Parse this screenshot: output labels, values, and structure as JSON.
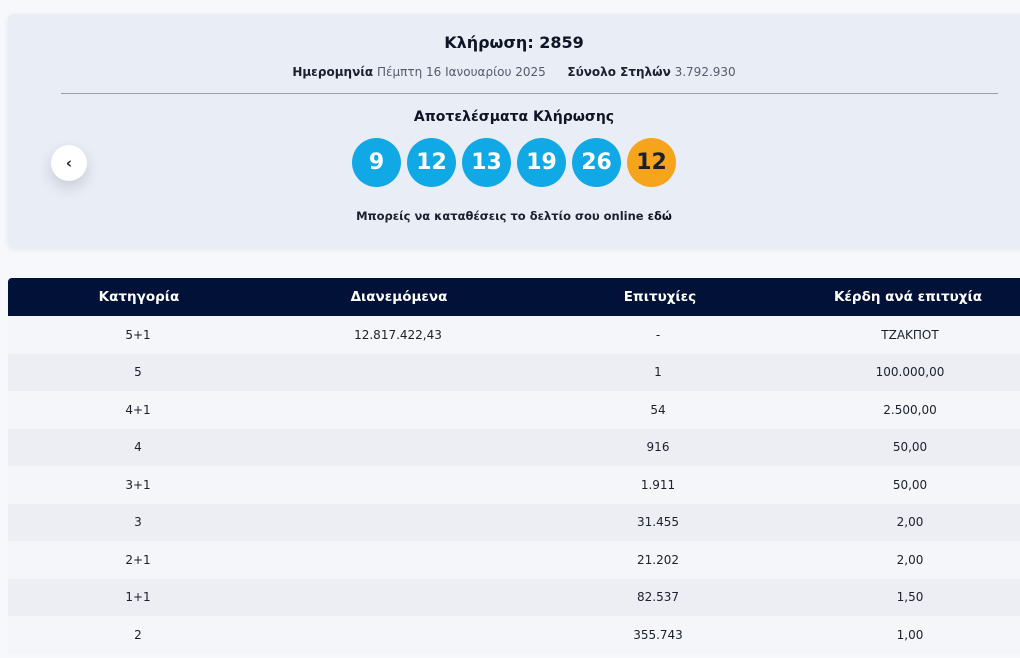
{
  "draw": {
    "title": "Κλήρωση: 2859",
    "date_label": "Ημερομηνία",
    "date_value": "Πέμπτη 16 Ιανουαρίου 2025",
    "columns_label": "Σύνολο Στηλών",
    "columns_value": "3.792.930",
    "results_title": "Αποτελέσματα Κλήρωσης",
    "numbers": [
      "9",
      "12",
      "13",
      "19",
      "26"
    ],
    "bonus": "12",
    "prev_icon": "chevron-left-icon",
    "prev_glyph": "‹",
    "online_text": "Μπορείς να καταθέσεις το δελτίο σου online",
    "online_link": "εδώ"
  },
  "colors": {
    "ball": "#10a9e5",
    "bonus_ball": "#f7a41d",
    "table_header": "#021138"
  },
  "table": {
    "headers": [
      "Κατηγορία",
      "Διανεμόμενα",
      "Επιτυχίες",
      "Κέρδη ανά επιτυχία"
    ],
    "rows": [
      [
        "5+1",
        "12.817.422,43",
        "-",
        "ΤΖΑΚΠΟΤ"
      ],
      [
        "5",
        "",
        "1",
        "100.000,00"
      ],
      [
        "4+1",
        "",
        "54",
        "2.500,00"
      ],
      [
        "4",
        "",
        "916",
        "50,00"
      ],
      [
        "3+1",
        "",
        "1.911",
        "50,00"
      ],
      [
        "3",
        "",
        "31.455",
        "2,00"
      ],
      [
        "2+1",
        "",
        "21.202",
        "2,00"
      ],
      [
        "1+1",
        "",
        "82.537",
        "1,50"
      ],
      [
        "2",
        "",
        "355.743",
        "1,00"
      ]
    ]
  }
}
